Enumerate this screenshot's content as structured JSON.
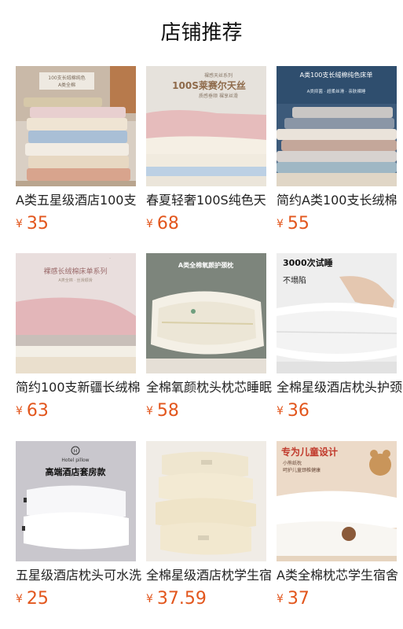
{
  "header": {
    "title": "店铺推荐"
  },
  "colors": {
    "price": "#e2561d",
    "title": "#111111"
  },
  "products": [
    {
      "name": "A类五星级酒店100支",
      "currency": "¥",
      "price": "35",
      "overlay": [
        "100支长绒棉纯色",
        "A类全棉"
      ]
    },
    {
      "name": "春夏轻奢100S纯色天",
      "currency": "¥",
      "price": "68",
      "overlay": [
        "裸感天丝系列",
        "100S莱赛尔天丝",
        "质感垂顺 裸享丝滑"
      ]
    },
    {
      "name": "简约A类100支长绒棉",
      "currency": "¥",
      "price": "55",
      "overlay": [
        "A类100支长绒棉纯色床单",
        "A类抑菌 · 超柔丝滑 · 亲肤裸睡"
      ]
    },
    {
      "name": "简约100支新疆长绒棉",
      "currency": "¥",
      "price": "63",
      "overlay": [
        "裸感长绒棉床单系列",
        "A类全棉 · 丝滑顺滑"
      ]
    },
    {
      "name": "全棉氧颜枕头枕芯睡眠",
      "currency": "¥",
      "price": "58",
      "overlay": [
        "A类全棉氧颜护颈枕"
      ]
    },
    {
      "name": "全棉星级酒店枕头护颈",
      "currency": "¥",
      "price": "36",
      "overlay": [
        "3000次试睡",
        "不塌陷"
      ]
    },
    {
      "name": "五星级酒店枕头可水洗",
      "currency": "¥",
      "price": "25",
      "overlay": [
        "Hotel pillow",
        "高端酒店套房款"
      ]
    },
    {
      "name": "全棉星级酒店枕学生宿舍",
      "currency": "¥",
      "price": "37.59",
      "overlay": []
    },
    {
      "name": "A类全棉枕芯学生宿舍",
      "currency": "¥",
      "price": "37",
      "overlay": [
        "专为儿童设计",
        "小熊纸枕",
        "呵护儿童颈椎健康"
      ]
    }
  ]
}
